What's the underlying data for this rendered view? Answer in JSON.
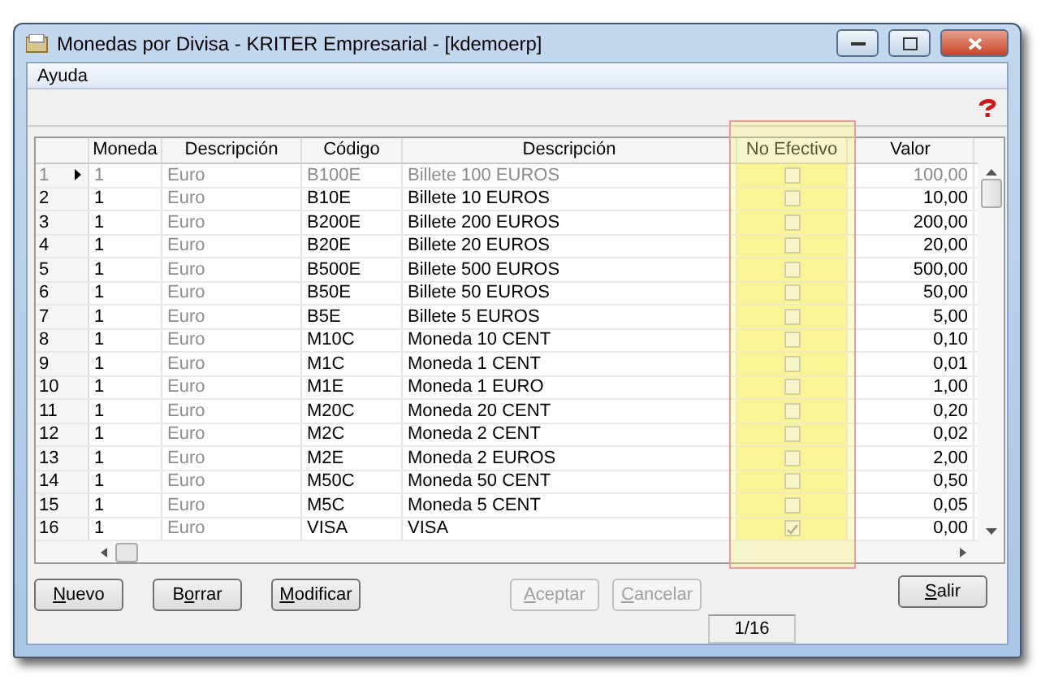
{
  "window": {
    "title": "Monedas por Divisa - KRITER Empresarial - [kdemoerp]"
  },
  "menu": [
    "Ayuda"
  ],
  "table": {
    "columns": [
      {
        "kind": "rownum"
      },
      {
        "label": "Moneda",
        "kind": "text"
      },
      {
        "label": "Descripción",
        "kind": "readonly"
      },
      {
        "label": "Código",
        "kind": "text"
      },
      {
        "label": "Descripción",
        "kind": "text"
      },
      {
        "label": "No Efectivo",
        "kind": "check",
        "highlighted": true
      },
      {
        "label": "Valor",
        "kind": "number"
      }
    ],
    "rows": [
      {
        "cells": [
          "1",
          "1",
          "Euro",
          "B100E",
          "Billete 100 EUROS",
          "100,00"
        ],
        "checked": false,
        "selected": true
      },
      {
        "cells": [
          "2",
          "1",
          "Euro",
          "B10E",
          "Billete 10 EUROS",
          "10,00"
        ],
        "checked": false,
        "selected": false
      },
      {
        "cells": [
          "3",
          "1",
          "Euro",
          "B200E",
          "Billete 200 EUROS",
          "200,00"
        ],
        "checked": false,
        "selected": false
      },
      {
        "cells": [
          "4",
          "1",
          "Euro",
          "B20E",
          "Billete 20 EUROS",
          "20,00"
        ],
        "checked": false,
        "selected": false
      },
      {
        "cells": [
          "5",
          "1",
          "Euro",
          "B500E",
          "Billete 500 EUROS",
          "500,00"
        ],
        "checked": false,
        "selected": false
      },
      {
        "cells": [
          "6",
          "1",
          "Euro",
          "B50E",
          "Billete 50 EUROS",
          "50,00"
        ],
        "checked": false,
        "selected": false
      },
      {
        "cells": [
          "7",
          "1",
          "Euro",
          "B5E",
          "Billete 5 EUROS",
          "5,00"
        ],
        "checked": false,
        "selected": false
      },
      {
        "cells": [
          "8",
          "1",
          "Euro",
          "M10C",
          "Moneda 10 CENT",
          "0,10"
        ],
        "checked": false,
        "selected": false
      },
      {
        "cells": [
          "9",
          "1",
          "Euro",
          "M1C",
          "Moneda 1 CENT",
          "0,01"
        ],
        "checked": false,
        "selected": false
      },
      {
        "cells": [
          "10",
          "1",
          "Euro",
          "M1E",
          "Moneda 1 EURO",
          "1,00"
        ],
        "checked": false,
        "selected": false
      },
      {
        "cells": [
          "11",
          "1",
          "Euro",
          "M20C",
          "Moneda 20 CENT",
          "0,20"
        ],
        "checked": false,
        "selected": false
      },
      {
        "cells": [
          "12",
          "1",
          "Euro",
          "M2C",
          "Moneda 2 CENT",
          "0,02"
        ],
        "checked": false,
        "selected": false
      },
      {
        "cells": [
          "13",
          "1",
          "Euro",
          "M2E",
          "Moneda 2 EUROS",
          "2,00"
        ],
        "checked": false,
        "selected": false
      },
      {
        "cells": [
          "14",
          "1",
          "Euro",
          "M50C",
          "Moneda 50 CENT",
          "0,50"
        ],
        "checked": false,
        "selected": false
      },
      {
        "cells": [
          "15",
          "1",
          "Euro",
          "M5C",
          "Moneda 5 CENT",
          "0,05"
        ],
        "checked": false,
        "selected": false
      },
      {
        "cells": [
          "16",
          "1",
          "Euro",
          "VISA",
          "VISA",
          "0,00"
        ],
        "checked": true,
        "selected": false
      }
    ]
  },
  "buttons_left": [
    {
      "key": "N",
      "post": "uevo",
      "disabled": false
    },
    {
      "pre": "B",
      "key": "o",
      "post": "rrar",
      "disabled": false
    },
    {
      "key": "M",
      "post": "odificar",
      "disabled": false
    }
  ],
  "buttons_center": [
    {
      "key": "A",
      "post": "ceptar",
      "disabled": true
    },
    {
      "key": "C",
      "post": "ancelar",
      "disabled": true
    }
  ],
  "buttons_right": [
    {
      "key": "S",
      "post": "alir",
      "disabled": false
    }
  ],
  "record_counter": "1/16"
}
